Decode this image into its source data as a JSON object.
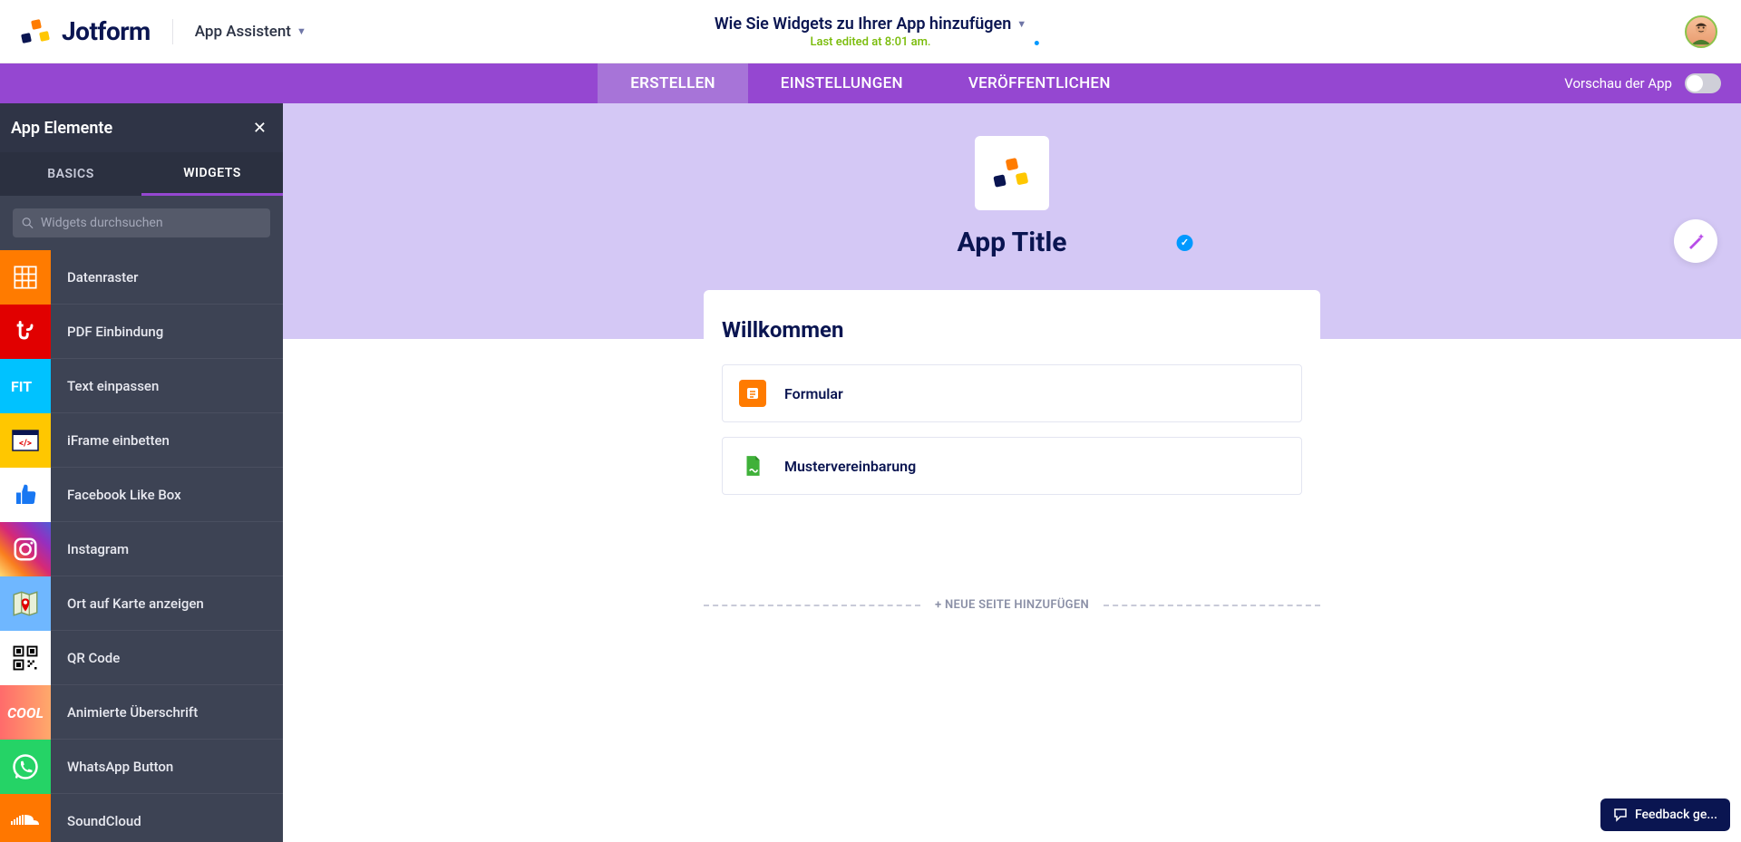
{
  "brand": {
    "name": "Jotform"
  },
  "header": {
    "assistent_label": "App Assistent",
    "app_name": "Wie Sie Widgets zu Ihrer App hinzufügen",
    "last_edited": "Last edited at 8:01 am."
  },
  "tabbar": {
    "tabs": [
      {
        "label": "ERSTELLEN",
        "active": true
      },
      {
        "label": "EINSTELLUNGEN",
        "active": false
      },
      {
        "label": "VERÖFFENTLICHEN",
        "active": false
      }
    ],
    "preview_label": "Vorschau der App"
  },
  "sidebar": {
    "title": "App Elemente",
    "tabs": {
      "basics": "BASICS",
      "widgets": "WIDGETS"
    },
    "search_placeholder": "Widgets durchsuchen",
    "widgets": [
      {
        "name": "Datenraster",
        "iconbg": "#ff7b00"
      },
      {
        "name": "PDF Einbindung",
        "iconbg": "#e10000"
      },
      {
        "name": "Text einpassen",
        "iconbg": "#00c2ff"
      },
      {
        "name": "iFrame einbetten",
        "iconbg": "#ffc700"
      },
      {
        "name": "Facebook Like Box",
        "iconbg": "#ffffff"
      },
      {
        "name": "Instagram",
        "iconbg": "#e1306c"
      },
      {
        "name": "Ort auf Karte anzeigen",
        "iconbg": "#6fb7ff"
      },
      {
        "name": "QR Code",
        "iconbg": "#ffffff"
      },
      {
        "name": "Animierte Überschrift",
        "iconbg": "#ff6b6b"
      },
      {
        "name": "WhatsApp Button",
        "iconbg": "#25d366"
      },
      {
        "name": "SoundCloud",
        "iconbg": "#ff7700"
      }
    ]
  },
  "canvas": {
    "app_title": "App Title",
    "welcome": "Willkommen",
    "rows": [
      {
        "label": "Formular",
        "color": "#ff7b00"
      },
      {
        "label": "Mustervereinbarung",
        "color": "#3fb139"
      }
    ],
    "add_page": "+ NEUE SEITE HINZUFÜGEN"
  },
  "feedback_label": "Feedback ge..."
}
